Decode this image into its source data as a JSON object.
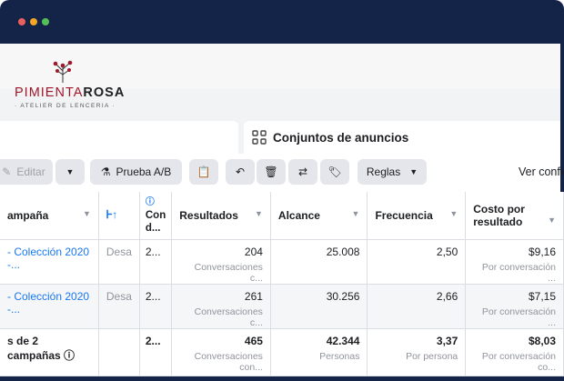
{
  "window": {
    "dot_colors": [
      "#e8615c",
      "#f5a623",
      "#55c057"
    ]
  },
  "brand": {
    "name_part1": "PIMIENTA",
    "name_part2": "ROSA",
    "tagline": "ATELIER DE LENCERIA"
  },
  "tab": {
    "label": "Conjuntos de anuncios"
  },
  "toolbar": {
    "edit_label": "Editar",
    "ab_test_label": "Prueba A/B",
    "rules_label": "Reglas",
    "view_config_label": "Ver configu"
  },
  "table": {
    "headers": {
      "campaign": "ampaña",
      "col2": "Con d...",
      "results": "Resultados",
      "reach": "Alcance",
      "frequency": "Frecuencia",
      "cost": "Costo por resultado"
    },
    "rows": [
      {
        "name": "- Colección 2020 -...",
        "status": "Desa",
        "col2": "2...",
        "results": "204",
        "results_sub": "Conversaciones c...",
        "reach": "25.008",
        "frequency": "2,50",
        "cost": "$9,16",
        "cost_sub": "Por conversación ..."
      },
      {
        "name": "- Colección 2020 -...",
        "status": "Desa",
        "col2": "2...",
        "results": "261",
        "results_sub": "Conversaciones c...",
        "reach": "30.256",
        "frequency": "2,66",
        "cost": "$7,15",
        "cost_sub": "Por conversación ..."
      }
    ],
    "total": {
      "name": "s de 2 campañas",
      "col2": "2...",
      "results": "465",
      "results_sub": "Conversaciones con...",
      "reach": "42.344",
      "reach_sub": "Personas",
      "frequency": "3,37",
      "frequency_sub": "Por persona",
      "cost": "$8,03",
      "cost_sub": "Por conversación co..."
    }
  }
}
